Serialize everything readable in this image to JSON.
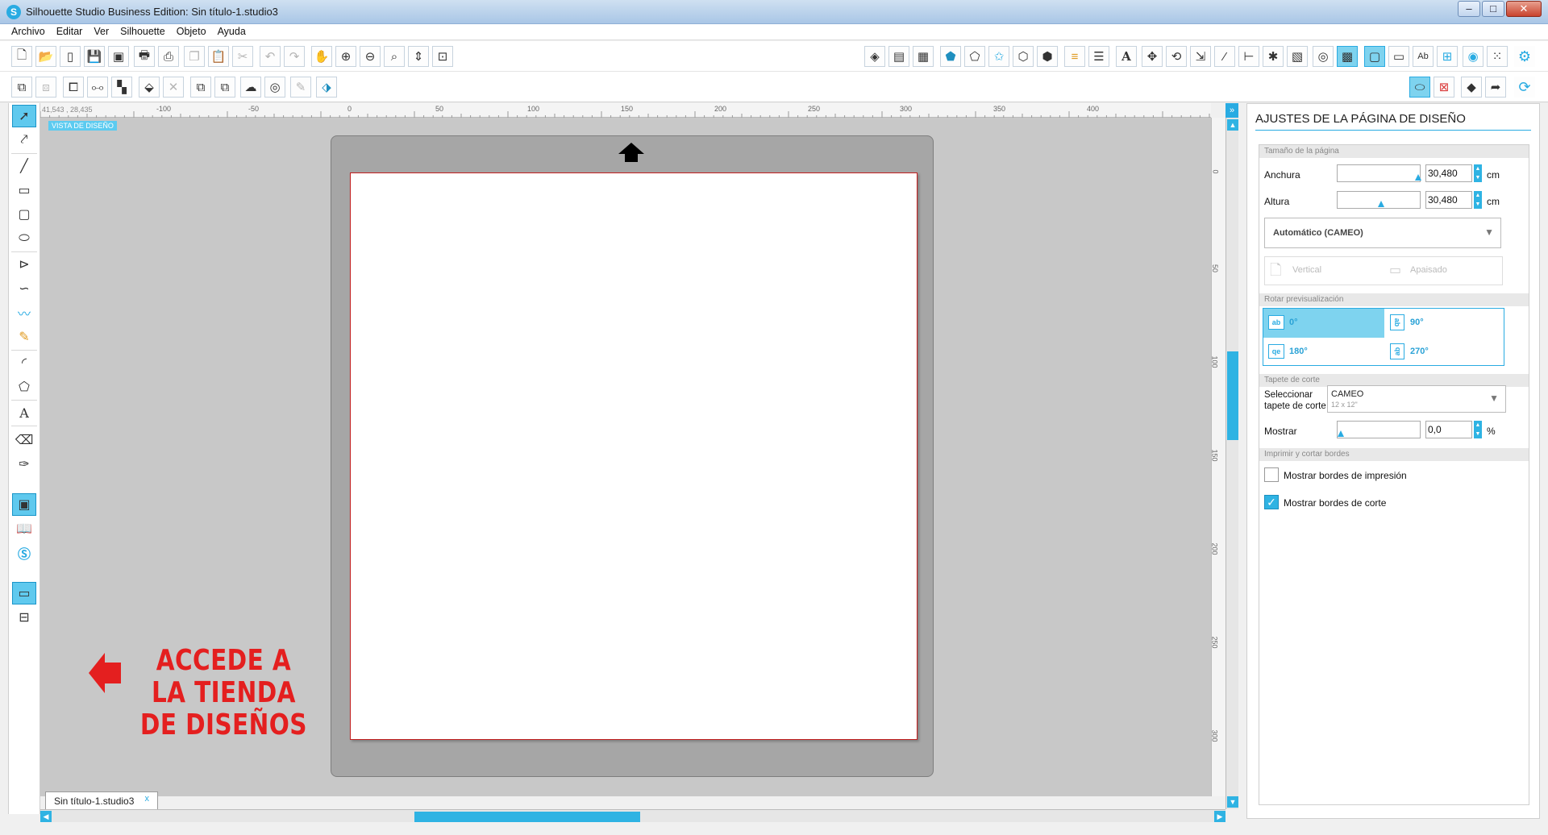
{
  "window": {
    "title": "Silhouette Studio Business Edition: Sin título-1.studio3",
    "app_icon": "S",
    "controls": {
      "minimize": "–",
      "maximize": "□",
      "close": "✕"
    }
  },
  "menu": [
    "Archivo",
    "Editar",
    "Ver",
    "Silhouette",
    "Objeto",
    "Ayuda"
  ],
  "toolbar1_icons": {
    "left": [
      "new-document-icon",
      "open-folder-icon",
      "open-tablet-icon",
      "save-icon",
      "save-library-icon",
      "print-icon",
      "send-to-cut-icon",
      "copy-icon",
      "paste-icon",
      "cut-icon",
      "undo-icon",
      "redo-icon",
      "pan-hand-icon",
      "zoom-in-icon",
      "zoom-out-icon",
      "zoom-select-icon",
      "drag-zoom-icon",
      "fit-to-page-icon"
    ],
    "right": [
      "fill-icon",
      "gradient-icon",
      "pattern-icon",
      "shape-pentagon-icon",
      "shape-polygon-icon",
      "shape-star-icon",
      "shape-badge-icon",
      "shape-custom-icon",
      "lines-color-icon",
      "lines-style-icon",
      "text-icon",
      "transform-icon",
      "rotate-icon",
      "scale-icon",
      "shear-icon",
      "align-icon",
      "replicate-icon",
      "nest-icon",
      "offset-icon",
      "trace-icon",
      "page-icon",
      "cut-settings-icon",
      "text-style-icon",
      "grid-icon",
      "spiral-icon",
      "dots-icon",
      "settings-gear-icon"
    ]
  },
  "toolbar2_icons": {
    "left": [
      "group-icon",
      "ungroup-icon",
      "compound-path-icon",
      "release-compound-icon",
      "arrange-icon",
      "weld-icon",
      "knife-icon",
      "bring-front-icon",
      "send-back-icon",
      "modify-icon",
      "offset-shape-icon",
      "trace-brush-icon",
      "cube-3d-icon"
    ],
    "right": [
      "design-view-icon",
      "cut-view-icon",
      "eraser-view-icon",
      "send-icon",
      "sync-icon"
    ]
  },
  "left_tools": [
    "select-arrow-icon",
    "point-edit-icon",
    "line-icon",
    "rectangle-icon",
    "rounded-rect-icon",
    "ellipse-icon",
    "polygon-icon",
    "curve-icon",
    "freehand-icon",
    "smooth-freehand-icon",
    "arc-icon",
    "regular-polygon-icon",
    "text-tool-icon",
    "eraser-icon",
    "knife-tool-icon",
    "design-area-icon",
    "library-icon",
    "design-store-icon",
    "single-view-icon",
    "split-view-icon"
  ],
  "ruler": {
    "coords": "41,543 , 28,435",
    "top_labels": [
      "-100",
      "-50",
      "0",
      "50",
      "100",
      "150",
      "200",
      "250",
      "300",
      "350",
      "400"
    ],
    "left_labels": [
      "0",
      "50",
      "100",
      "150",
      "200",
      "250",
      "300"
    ]
  },
  "canvas": {
    "view_tag": "VISTA DE DISEÑO",
    "annotation": "ACCEDE A LA TIENDA DE DISEÑOS",
    "annotation_color": "#e41f1f"
  },
  "doc_tab": {
    "label": "Sin título-1.studio3",
    "close": "x"
  },
  "panel": {
    "title": "AJUSTES DE LA PÁGINA DE DISEÑO",
    "page_size_section": "Tamaño de la página",
    "width_label": "Anchura",
    "width_value": "30,480",
    "height_label": "Altura",
    "height_value": "30,480",
    "unit": "cm",
    "media": "Automático (CAMEO)",
    "orient_vertical": "Vertical",
    "orient_landscape": "Apaisado",
    "rotate_section": "Rotar previsualización",
    "rotations": [
      "0°",
      "90°",
      "180°",
      "270°"
    ],
    "rotation_icons": [
      "ab",
      "ab",
      "qe",
      "ab"
    ],
    "mat_section": "Tapete de corte",
    "mat_select_label_1": "Seleccionar",
    "mat_select_label_2": "tapete de corte",
    "mat_value": "CAMEO",
    "mat_subvalue": "12 x 12\"",
    "show_label": "Mostrar",
    "show_value": "0,0",
    "show_unit": "%",
    "borders_section": "Imprimir y cortar bordes",
    "print_borders": "Mostrar bordes de impresión",
    "print_borders_checked": false,
    "cut_borders": "Mostrar bordes de corte",
    "cut_borders_checked": true,
    "accent": "#29abe2"
  }
}
